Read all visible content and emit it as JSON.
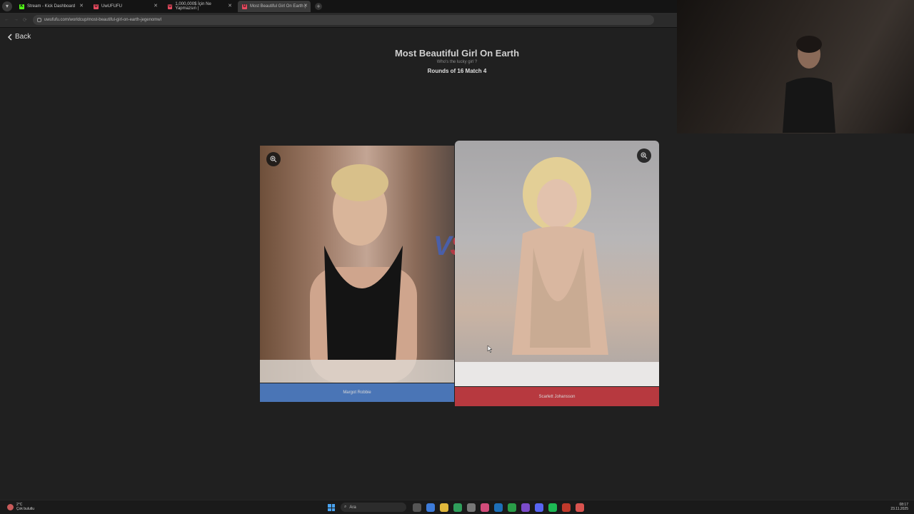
{
  "browser": {
    "tabs": [
      {
        "label": "Stream - Kick Dashboard",
        "favicon": "K",
        "color": "#53fc18"
      },
      {
        "label": "UwUFUFU",
        "favicon": "U",
        "color": "#e84a5f"
      },
      {
        "label": "1,000,000$ İçin Ne Yapmazsın |",
        "favicon": "U",
        "color": "#e84a5f"
      },
      {
        "label": "Most Beautiful Girl On Earth |",
        "favicon": "U",
        "color": "#e84a5f",
        "active": true
      }
    ],
    "url": "uwufufu.com/worldcup/most-beautiful-girl-on-earth-jegenomwl"
  },
  "page": {
    "back_label": "Back",
    "title": "Most Beautiful Girl On Earth",
    "subtitle": "Who's the lucky girl ?",
    "round": "Rounds of 16 Match 4",
    "vs": {
      "v": "V",
      "s": "S"
    },
    "left": {
      "name": "Margot Robbie",
      "color": "#4a75b6"
    },
    "right": {
      "name": "Scarlett Johansson",
      "color": "#b7393f"
    }
  },
  "taskbar": {
    "weather_temp": "2°C",
    "weather_desc": "Çok bulutlu",
    "search_placeholder": "Ara",
    "time": "08:17",
    "date": "23.11.2025"
  }
}
